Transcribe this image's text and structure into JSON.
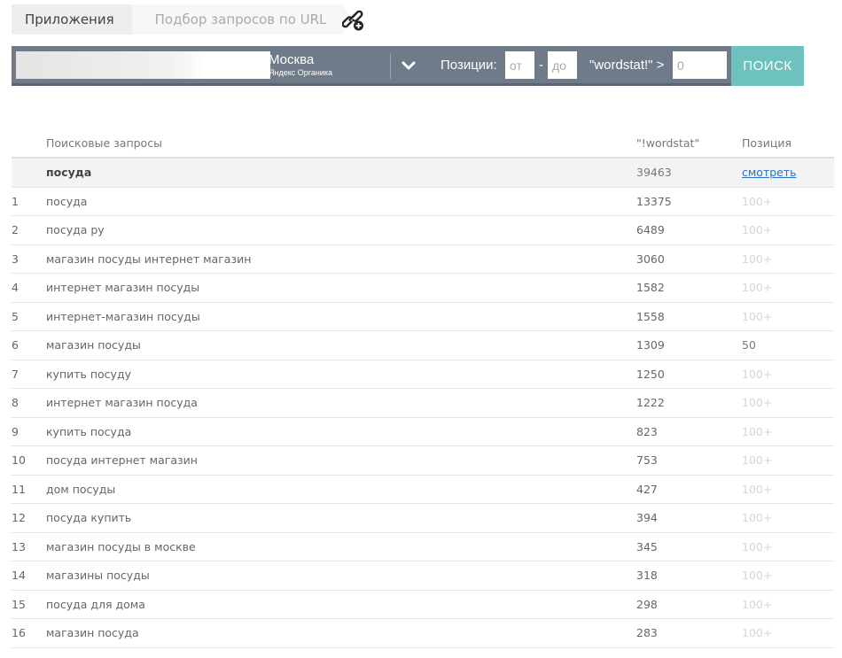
{
  "breadcrumb": {
    "apps": "Приложения",
    "current": "Подбор запросов по URL"
  },
  "toolbar": {
    "url_value": "",
    "region_city": "Москва",
    "region_engine": "Яндекс Органика",
    "positions_label": "Позиции:",
    "from_placeholder": "от",
    "dash": "-",
    "to_placeholder": "до",
    "wordstat_label": "\"wordstat!\" >",
    "wordstat_placeholder": "0",
    "search_label": "ПОИСК"
  },
  "table": {
    "headers": {
      "query": "Поисковые запросы",
      "wordstat": "\"!wordstat\"",
      "position": "Позиция"
    },
    "summary": {
      "query": "посуда",
      "wordstat": "39463",
      "position": "смотреть"
    },
    "rows": [
      {
        "num": "1",
        "query": "посуда",
        "wordstat": "13375",
        "position": "100+"
      },
      {
        "num": "2",
        "query": "посуда ру",
        "wordstat": "6489",
        "position": "100+"
      },
      {
        "num": "3",
        "query": "магазин посуды интернет магазин",
        "wordstat": "3060",
        "position": "100+"
      },
      {
        "num": "4",
        "query": "интернет магазин посуды",
        "wordstat": "1582",
        "position": "100+"
      },
      {
        "num": "5",
        "query": "интернет-магазин посуды",
        "wordstat": "1558",
        "position": "100+"
      },
      {
        "num": "6",
        "query": "магазин посуды",
        "wordstat": "1309",
        "position": "50"
      },
      {
        "num": "7",
        "query": "купить посуду",
        "wordstat": "1250",
        "position": "100+"
      },
      {
        "num": "8",
        "query": "интернет магазин посуда",
        "wordstat": "1222",
        "position": "100+"
      },
      {
        "num": "9",
        "query": "купить посуда",
        "wordstat": "823",
        "position": "100+"
      },
      {
        "num": "10",
        "query": "посуда интернет магазин",
        "wordstat": "753",
        "position": "100+"
      },
      {
        "num": "11",
        "query": "дом посуды",
        "wordstat": "427",
        "position": "100+"
      },
      {
        "num": "12",
        "query": "посуда купить",
        "wordstat": "394",
        "position": "100+"
      },
      {
        "num": "13",
        "query": "магазин посуды в москве",
        "wordstat": "345",
        "position": "100+"
      },
      {
        "num": "14",
        "query": "магазины посуды",
        "wordstat": "318",
        "position": "100+"
      },
      {
        "num": "15",
        "query": "посуда для дома",
        "wordstat": "298",
        "position": "100+"
      },
      {
        "num": "16",
        "query": "магазин посуда",
        "wordstat": "283",
        "position": "100+"
      }
    ]
  },
  "icons": {
    "add_link": "link-add-icon",
    "dropdown": "chevron-down-icon"
  },
  "colors": {
    "toolbar_bg": "#6f7b89",
    "search_button": "#6ec2bd",
    "link": "#2a72c4"
  }
}
